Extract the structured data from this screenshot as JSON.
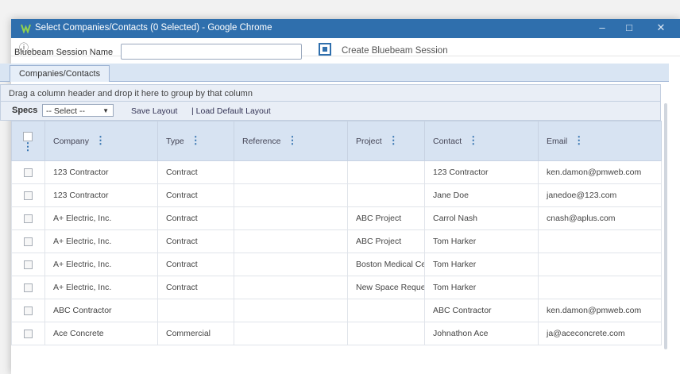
{
  "window": {
    "title": "Select Companies/Contacts (0 Selected) - Google Chrome",
    "minimize_glyph": "–",
    "maximize_glyph": "□",
    "close_glyph": "✕",
    "info_glyph": "ⓘ"
  },
  "session": {
    "label": "Bluebeam Session Name",
    "value": "",
    "create_label": "Create Bluebeam Session"
  },
  "tabs": [
    {
      "label": "Companies/Contacts"
    }
  ],
  "group_hint": "Drag a column header and drop it here to group by that column",
  "toolbar": {
    "specs_label": "Specs",
    "select_value": "-- Select --",
    "save_layout": "Save Layout",
    "load_default_layout": "| Load Default Layout"
  },
  "columns": [
    "Company",
    "Type",
    "Reference",
    "Project",
    "Contact",
    "Email"
  ],
  "rows": [
    {
      "company": "123 Contractor",
      "type": "Contract",
      "reference": "",
      "project": "",
      "contact": "123 Contractor",
      "email": "ken.damon@pmweb.com"
    },
    {
      "company": "123 Contractor",
      "type": "Contract",
      "reference": "",
      "project": "",
      "contact": "Jane Doe",
      "email": "janedoe@123.com"
    },
    {
      "company": "A+ Electric, Inc.",
      "type": "Contract",
      "reference": "",
      "project": "ABC Project",
      "contact": "Carrol Nash",
      "email": "cnash@aplus.com"
    },
    {
      "company": "A+ Electric, Inc.",
      "type": "Contract",
      "reference": "",
      "project": "ABC Project",
      "contact": "Tom Harker",
      "email": ""
    },
    {
      "company": "A+ Electric, Inc.",
      "type": "Contract",
      "reference": "",
      "project": "Boston Medical Ce",
      "contact": "Tom Harker",
      "email": ""
    },
    {
      "company": "A+ Electric, Inc.",
      "type": "Contract",
      "reference": "",
      "project": "New Space Reque",
      "contact": "Tom Harker",
      "email": ""
    },
    {
      "company": "ABC Contractor",
      "type": "",
      "reference": "",
      "project": "",
      "contact": "ABC Contractor",
      "email": "ken.damon@pmweb.com"
    },
    {
      "company": "Ace Concrete",
      "type": "Commercial",
      "reference": "",
      "project": "",
      "contact": "Johnathon Ace",
      "email": "ja@aceconcrete.com"
    }
  ],
  "colors": {
    "titlebar": "#2f6fad",
    "header_bg": "#d7e3f2",
    "accent": "#2f6fad"
  },
  "icons": {
    "kebab": "⋮",
    "logo": "pmweb-logo-icon",
    "bluebeam": "bluebeam-icon"
  }
}
